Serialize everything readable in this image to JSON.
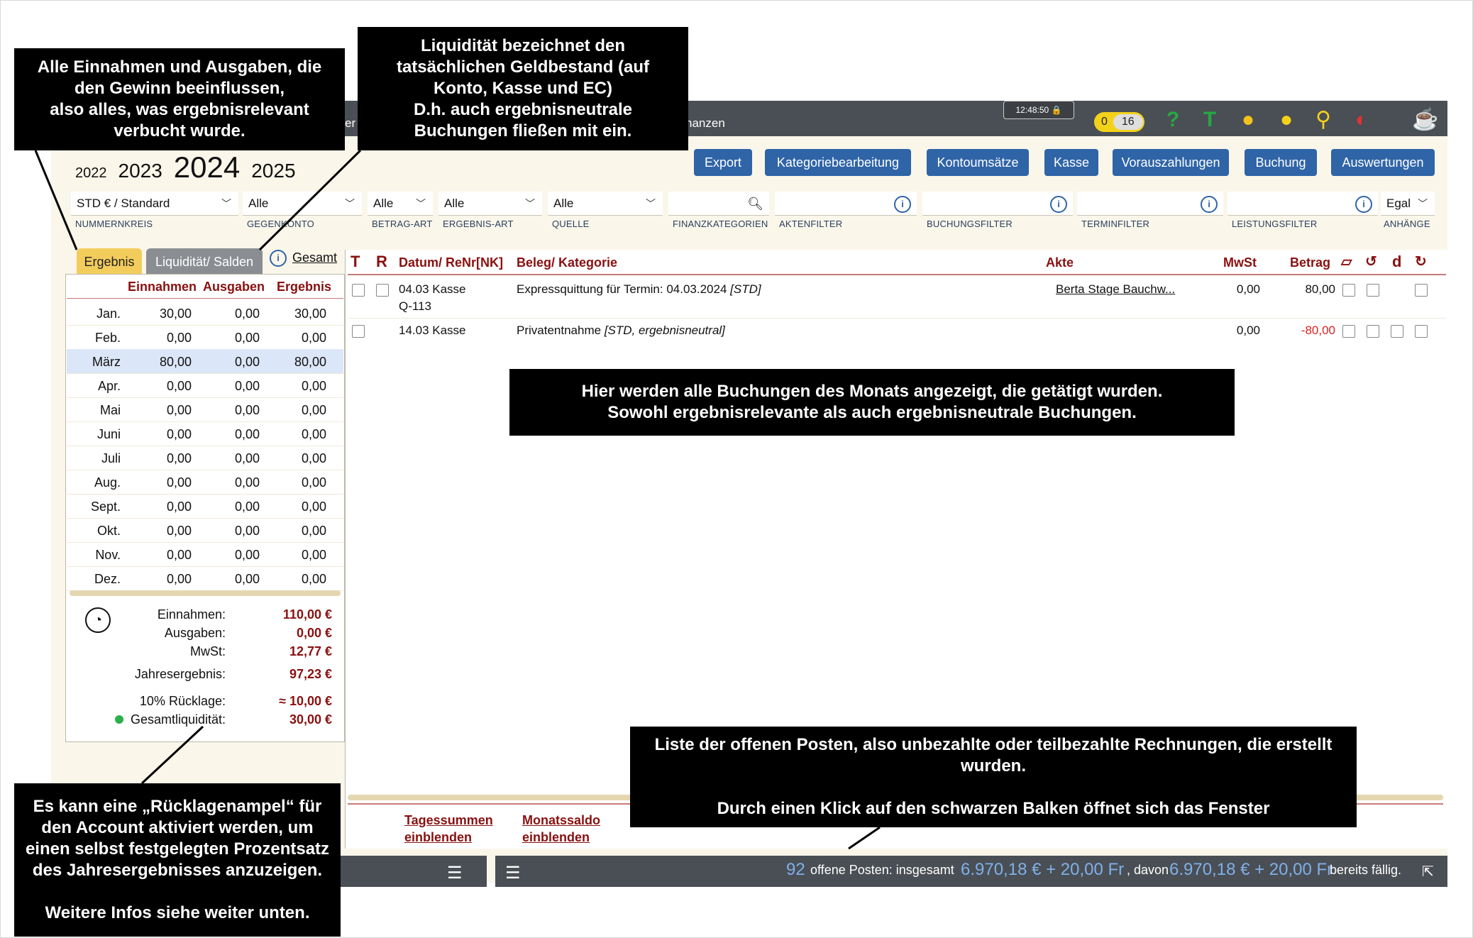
{
  "topbar": {
    "tab1": "er",
    "tab2": "nanzen",
    "clock": "12:48:50",
    "counter_zero": "0",
    "counter_count": "16"
  },
  "toolbar_icons": [
    "help-icon",
    "tax-icon",
    "user-add-icon",
    "chat-icon",
    "search-icon",
    "flags-icon",
    "coffee-icon"
  ],
  "buttons": [
    "Export",
    "Kategoriebearbeitung",
    "Kontoumsätze",
    "Kasse",
    "Vorauszahlungen",
    "Buchung",
    "Auswertungen"
  ],
  "years": {
    "y2022": "2022",
    "y2023": "2023",
    "y2024": "2024",
    "y2025": "2025"
  },
  "filters": {
    "nummernkreis": {
      "value": "STD € / Standard",
      "label": "NUMMERNKREIS"
    },
    "gegenkonto": {
      "value": "Alle",
      "label": "GEGENKONTO"
    },
    "betragart": {
      "value": "Alle",
      "label": "BETRAG-ART"
    },
    "ergebnisart": {
      "value": "Alle",
      "label": "ERGEBNIS-ART"
    },
    "quelle": {
      "value": "Alle",
      "label": "QUELLE"
    },
    "finanzkategorien": {
      "value": "",
      "label": "FINANZKATEGORIEN"
    },
    "aktenfilter": {
      "value": "",
      "label": "AKTENFILTER"
    },
    "buchungsfilter": {
      "value": "",
      "label": "BUCHUNGSFILTER"
    },
    "terminfilter": {
      "value": "",
      "label": "TERMINFILTER"
    },
    "leistungsfilter": {
      "value": "",
      "label": "LEISTUNGSFILTER"
    },
    "anhaenge": {
      "value": "Egal",
      "label": "ANHÄNGE"
    }
  },
  "tabs": {
    "ergebnis": "Ergebnis",
    "liquiditaet": "Liquidität/ Salden",
    "gesamt": "Gesamt"
  },
  "left": {
    "headers": {
      "einnahmen": "Einnahmen",
      "ausgaben": "Ausgaben",
      "ergebnis": "Ergebnis"
    },
    "months": [
      {
        "m": "Jan.",
        "e": "30,00",
        "a": "0,00",
        "r": "30,00"
      },
      {
        "m": "Feb.",
        "e": "0,00",
        "a": "0,00",
        "r": "0,00"
      },
      {
        "m": "März",
        "e": "80,00",
        "a": "0,00",
        "r": "80,00"
      },
      {
        "m": "Apr.",
        "e": "0,00",
        "a": "0,00",
        "r": "0,00"
      },
      {
        "m": "Mai",
        "e": "0,00",
        "a": "0,00",
        "r": "0,00"
      },
      {
        "m": "Juni",
        "e": "0,00",
        "a": "0,00",
        "r": "0,00"
      },
      {
        "m": "Juli",
        "e": "0,00",
        "a": "0,00",
        "r": "0,00"
      },
      {
        "m": "Aug.",
        "e": "0,00",
        "a": "0,00",
        "r": "0,00"
      },
      {
        "m": "Sept.",
        "e": "0,00",
        "a": "0,00",
        "r": "0,00"
      },
      {
        "m": "Okt.",
        "e": "0,00",
        "a": "0,00",
        "r": "0,00"
      },
      {
        "m": "Nov.",
        "e": "0,00",
        "a": "0,00",
        "r": "0,00"
      },
      {
        "m": "Dez.",
        "e": "0,00",
        "a": "0,00",
        "r": "0,00"
      }
    ],
    "summary": {
      "einnahmen_label": "Einnahmen:",
      "einnahmen": "110,00 €",
      "ausgaben_label": "Ausgaben:",
      "ausgaben": "0,00 €",
      "mwst_label": "MwSt:",
      "mwst": "12,77 €",
      "jahres_label": "Jahresergebnis:",
      "jahres": "97,23 €",
      "ruecklage_label": "10% Rücklage:",
      "ruecklage": "≈ 10,00 €",
      "liq_label": "Gesamtliquidität:",
      "liq": "30,00 €"
    }
  },
  "right": {
    "headers": {
      "datum": "Datum/ ReNr[NK]",
      "beleg": "Beleg/ Kategorie",
      "akte": "Akte",
      "mwst": "MwSt",
      "betrag": "Betrag"
    },
    "rows": [
      {
        "datum": "04.03 Kasse",
        "renr": "Q-113",
        "beleg": "Expressquittung für Termin: 04.03.2024",
        "tag": "[STD]",
        "akte": "Berta Stage Bauchw...",
        "mwst": "0,00",
        "betrag": "80,00"
      },
      {
        "datum": "14.03 Kasse",
        "renr": "",
        "beleg": "Privatentnahme",
        "tag": "[STD, ergebnisneutral]",
        "akte": "",
        "mwst": "0,00",
        "betrag": "-80,00"
      }
    ],
    "footer": {
      "tages1": "Tagessummen",
      "tages2": "einblenden",
      "monat1": "Monatssaldo",
      "monat2": "einblenden"
    }
  },
  "bottombar": {
    "count": "92",
    "t1": "offene Posten: insgesamt",
    "sum1": "6.970,18 € + 20,00 Fr",
    "t2": ", davon",
    "sum2": "6.970,18 € + 20,00 Fr",
    "t3": "bereits fällig."
  },
  "annotations": {
    "a1": "Alle Einnahmen und Ausgaben, die\nden Gewinn beeinflussen,\nalso alles, was ergebnisrelevant\nverbucht wurde.",
    "a2": "Liquidität bezeichnet den\ntatsächlichen Geldbestand (auf\nKonto, Kasse und EC)\nD.h. auch ergebnisneutrale\nBuchungen fließen mit ein.",
    "a3": "Hier werden alle Buchungen des Monats angezeigt, die getätigt wurden.\nSowohl ergebnisrelevante als auch ergebnisneutrale Buchungen.",
    "a4": "Liste der offenen Posten, also unbezahlte oder teilbezahlte Rechnungen, die erstellt\nwurden.\n\nDurch einen Klick auf den schwarzen Balken öffnet sich das Fenster",
    "a5": "Es kann eine „Rücklagenampel“ für\nden Account aktiviert werden, um\neinen selbst festgelegten Prozentsatz\ndes Jahresergebnisses anzuzeigen.\n\nWeitere Infos siehe weiter unten."
  },
  "colors": {
    "accent": "#2f64a7",
    "dark_red": "#8a1010",
    "topbar": "#4a4f55",
    "tab_active": "#f3cd5c",
    "selected_row": "#dbe6f8"
  }
}
